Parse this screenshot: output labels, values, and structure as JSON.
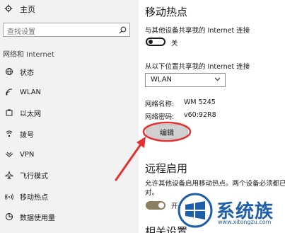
{
  "sidebar": {
    "home_label": "主页",
    "search_placeholder": "查找设置",
    "section_title": "网络和 Internet",
    "items": [
      {
        "label": "状态",
        "icon": "globe-icon"
      },
      {
        "label": "WLAN",
        "icon": "wifi-icon"
      },
      {
        "label": "以太网",
        "icon": "ethernet-icon"
      },
      {
        "label": "拨号",
        "icon": "dialup-icon"
      },
      {
        "label": "VPN",
        "icon": "vpn-icon"
      },
      {
        "label": "飞行模式",
        "icon": "airplane-icon"
      },
      {
        "label": "移动热点",
        "icon": "hotspot-icon"
      },
      {
        "label": "数据使用量",
        "icon": "data-usage-icon"
      }
    ],
    "active_item": "移动热点"
  },
  "main": {
    "title": "移动热点",
    "share_label": "与其他设备共享我的 Internet 连接",
    "share_toggle_state": "关",
    "share_from_label": "从以下位置共享我的 Internet 连接",
    "share_from_value": "WLAN",
    "network_name_label": "网络名称:",
    "network_name_value": "WM 5245",
    "network_password_label": "网络密码:",
    "network_password_value": "v60:92R8",
    "edit_button": "编辑",
    "remote_title": "远程启用",
    "remote_desc_line1": "允许其他设备启用移动热点。两个设备必须都已",
    "remote_desc_line2": "对。",
    "remote_toggle_state": "开",
    "related_title": "相关设置"
  },
  "watermark": {
    "text": "系统族",
    "url": "www.xitongzu.com"
  },
  "colors": {
    "sidebar_bg": "#f2f2f2",
    "annotation_red": "#e53030",
    "toggle_on": "#8a7f63",
    "watermark_blue": "#1e5fa8"
  }
}
